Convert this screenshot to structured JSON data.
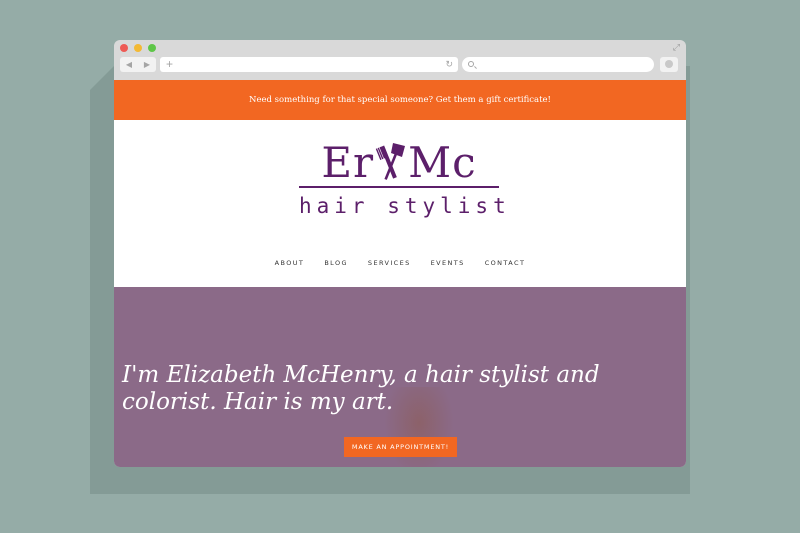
{
  "announcement": {
    "text": "Need something for that special someone? Get them a gift certificate!"
  },
  "logo": {
    "left": "Er",
    "right": "Mc",
    "subtitle": "hair stylist"
  },
  "nav": {
    "items": [
      "ABOUT",
      "BLOG",
      "SERVICES",
      "EVENTS",
      "CONTACT"
    ]
  },
  "hero": {
    "headline": "I'm Elizabeth McHenry, a hair stylist and colorist. Hair is my art.",
    "cta_label": "MAKE AN APPOINTMENT!"
  },
  "colors": {
    "accent": "#f26722",
    "brand_purple": "#5c1f6a",
    "hero_bg": "#8b6a88",
    "backdrop": "#95aca7"
  },
  "icons": [
    "back-arrow-icon",
    "forward-arrow-icon",
    "new-tab-plus-icon",
    "reload-icon",
    "search-icon",
    "expand-icon",
    "comb-icon",
    "brush-icon"
  ]
}
